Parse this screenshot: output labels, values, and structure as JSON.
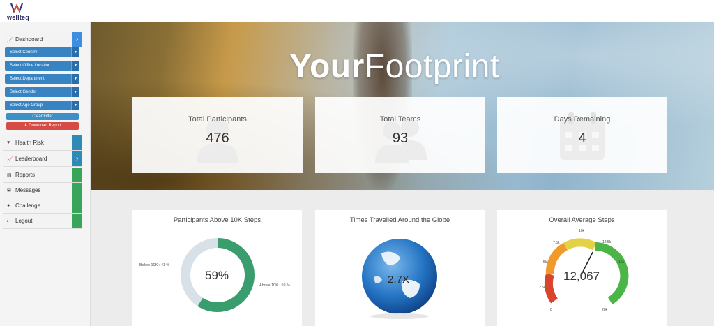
{
  "brand": {
    "name": "wellteq"
  },
  "sidebar": {
    "dashboard": "Dashboard",
    "filters": [
      "Select Country",
      "Select Office Location",
      "Select Department",
      "Select Gender",
      "Select Age Group"
    ],
    "clear_filter": "Clear Filter",
    "download_report": "Download Report",
    "items": [
      {
        "label": "Health Risk",
        "icon": "heart-icon"
      },
      {
        "label": "Leaderboard",
        "icon": "chart-icon"
      },
      {
        "label": "Reports",
        "icon": "document-icon"
      },
      {
        "label": "Messages",
        "icon": "envelope-icon"
      },
      {
        "label": "Challenge",
        "icon": "info-icon"
      },
      {
        "label": "Logout",
        "icon": "logout-icon"
      }
    ]
  },
  "hero": {
    "title_bold": "Your",
    "title_light": "Footprint"
  },
  "stats": [
    {
      "label": "Total Participants",
      "value": "476"
    },
    {
      "label": "Total Teams",
      "value": "93"
    },
    {
      "label": "Days Remaining",
      "value": "4"
    }
  ],
  "cards": {
    "steps": {
      "title": "Participants Above 10K Steps",
      "percent": "59%",
      "below_label": "Below 10K : 41 %",
      "above_label": "Above 10K : 59 %",
      "above_fraction": 0.59
    },
    "globe": {
      "title": "Times Travelled Around the Globe",
      "value": "2.7X"
    },
    "gauge": {
      "title": "Overall Average Steps",
      "value": "12,067",
      "ticks": [
        "0",
        "2.5k",
        "5k",
        "7.5k",
        "10k",
        "12.5k",
        "15k",
        "20k"
      ],
      "max": 20000,
      "current": 12067
    }
  },
  "colors": {
    "accent": "#3d8ede",
    "green": "#3aa55a",
    "danger": "#d64b43"
  }
}
